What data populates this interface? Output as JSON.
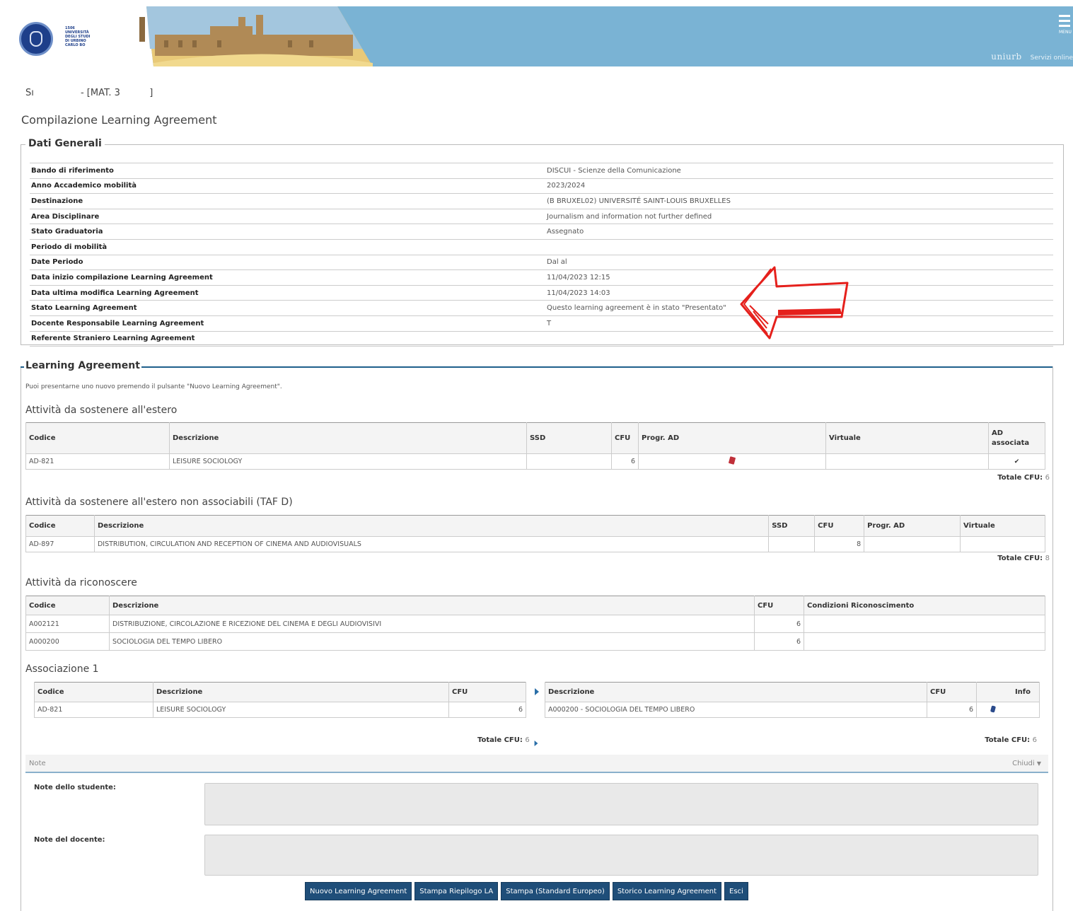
{
  "header": {
    "logo_lines": [
      "1506",
      "UNIVERSITÀ",
      "DEGLI STUDI",
      "DI URBINO",
      "CARLO BO"
    ],
    "menu_label": "MENU",
    "brand": "uniurb",
    "services": "Servizi online"
  },
  "student": {
    "text": "Sı                - [MAT. 3          ]"
  },
  "page_title": "Compilazione Learning Agreement",
  "dati_generali": {
    "legend": "Dati Generali",
    "rows": [
      {
        "label": "Bando di riferimento",
        "value": "DISCUI - Scienze della Comunicazione"
      },
      {
        "label": "Anno Accademico mobilità",
        "value": "2023/2024"
      },
      {
        "label": "Destinazione",
        "value": "(B BRUXEL02) UNIVERSITÉ SAINT-LOUIS BRUXELLES"
      },
      {
        "label": "Area Disciplinare",
        "value": "Journalism and information not further defined"
      },
      {
        "label": "Stato Graduatoria",
        "value": "Assegnato"
      },
      {
        "label": "Periodo di mobilità",
        "value": ""
      },
      {
        "label": "Date Periodo",
        "value": "Dal  al"
      },
      {
        "label": "Data inizio compilazione Learning Agreement",
        "value": "11/04/2023 12:15"
      },
      {
        "label": "Data ultima modifica Learning Agreement",
        "value": "11/04/2023 14:03"
      },
      {
        "label": "Stato Learning Agreement",
        "value": "Questo learning agreement è in stato \"Presentato\""
      },
      {
        "label": "Docente Responsabile Learning Agreement",
        "value": "T"
      },
      {
        "label": "Referente Straniero Learning Agreement",
        "value": ""
      }
    ]
  },
  "annotation_color": "#e5201c",
  "learning_agreement": {
    "legend": "Learning Agreement",
    "intro": "Puoi presentarne uno nuovo premendo il pulsante \"Nuovo Learning Agreement\".",
    "estero": {
      "title": "Attività da sostenere all'estero",
      "headers": [
        "Codice",
        "Descrizione",
        "SSD",
        "CFU",
        "Progr. AD",
        "Virtuale",
        "AD associata"
      ],
      "row": {
        "codice": "AD-821",
        "descrizione": "LEISURE SOCIOLOGY",
        "ssd": "",
        "cfu": "6",
        "progr_icon": "pdf-icon",
        "virtuale": "",
        "assoc_icon": "check-icon"
      },
      "totale_label": "Totale CFU:",
      "totale_value": "6"
    },
    "taf_d": {
      "title": "Attività da sostenere all'estero non associabili (TAF D)",
      "headers": [
        "Codice",
        "Descrizione",
        "SSD",
        "CFU",
        "Progr. AD",
        "Virtuale"
      ],
      "row": {
        "codice": "AD-897",
        "descrizione": "DISTRIBUTION, CIRCULATION AND RECEPTION OF CINEMA AND AUDIOVISUALS",
        "ssd": "",
        "cfu": "8",
        "progr": "",
        "virtuale": ""
      },
      "totale_label": "Totale CFU:",
      "totale_value": "8"
    },
    "riconoscere": {
      "title": "Attività da riconoscere",
      "headers": [
        "Codice",
        "Descrizione",
        "CFU",
        "Condizioni Riconoscimento"
      ],
      "rows": [
        {
          "codice": "A002121",
          "descrizione": "DISTRIBUZIONE, CIRCOLAZIONE E RICEZIONE DEL CINEMA E DEGLI AUDIOVISIVI",
          "cfu": "6",
          "cond": ""
        },
        {
          "codice": "A000200",
          "descrizione": "SOCIOLOGIA DEL TEMPO LIBERO",
          "cfu": "6",
          "cond": ""
        }
      ]
    },
    "associazione": {
      "title": "Associazione 1",
      "left_headers": [
        "Codice",
        "Descrizione",
        "CFU"
      ],
      "left_row": {
        "codice": "AD-821",
        "descrizione": "LEISURE SOCIOLOGY",
        "cfu": "6"
      },
      "right_headers": [
        "Descrizione",
        "CFU",
        "Info"
      ],
      "right_row": {
        "descrizione": "A000200 - SOCIOLOGIA DEL TEMPO LIBERO",
        "cfu": "6",
        "info_icon": "info-icon"
      },
      "totale_left_label": "Totale CFU:",
      "totale_left_value": "6",
      "totale_right_label": "Totale CFU:",
      "totale_right_value": "6"
    },
    "note": {
      "bar_label": "Note",
      "toggle_label": "Chiudi",
      "studente_label": "Note dello studente:",
      "studente_value": "",
      "docente_label": "Note del docente:",
      "docente_value": ""
    },
    "buttons": [
      "Nuovo Learning Agreement",
      "Stampa Riepilogo LA",
      "Stampa (Standard Europeo)",
      "Storico Learning Agreement",
      "Esci"
    ]
  }
}
